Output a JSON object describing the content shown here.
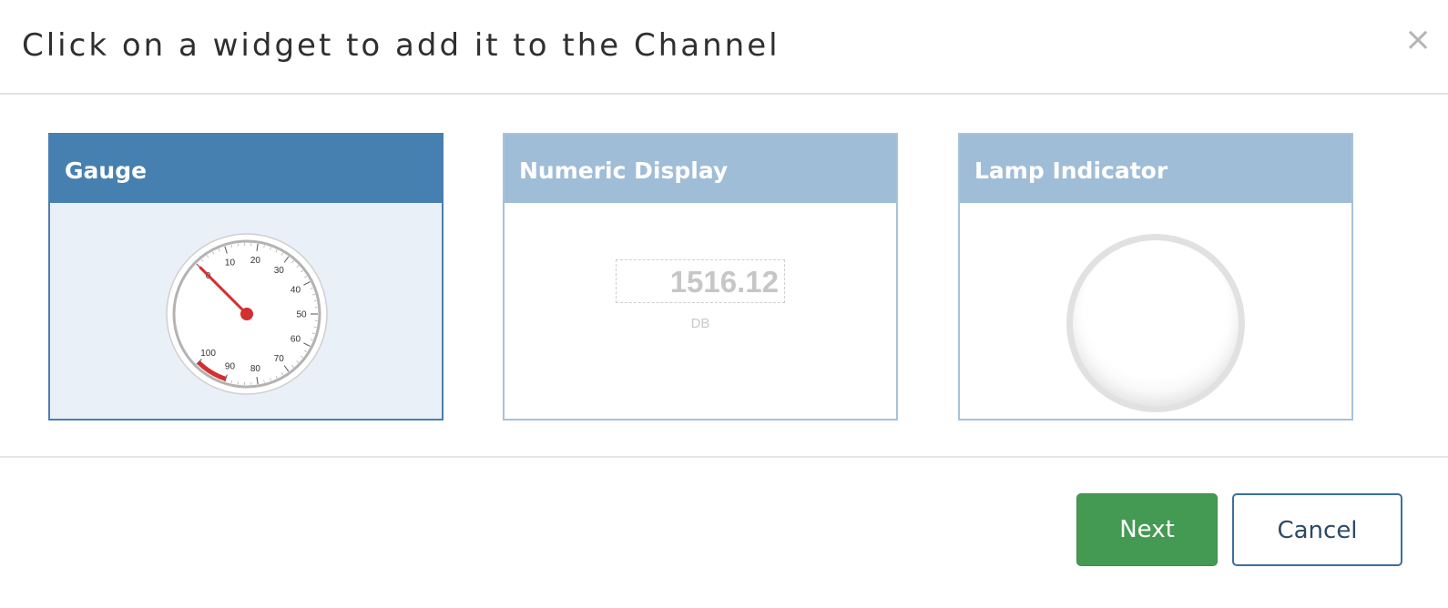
{
  "dialog": {
    "title": "Click on a widget to add it to the Channel",
    "close_label": "×"
  },
  "widgets": [
    {
      "title": "Gauge",
      "selected": true,
      "gauge": {
        "min": 0,
        "max": 100,
        "value": 0,
        "tick_labels": [
          "0",
          "10",
          "20",
          "30",
          "40",
          "50",
          "60",
          "70",
          "80",
          "90",
          "100"
        ],
        "red_zone": [
          90,
          100
        ],
        "needle_color": "#d32f2f"
      }
    },
    {
      "title": "Numeric Display",
      "selected": false,
      "value": "1516.12",
      "unit": "DB"
    },
    {
      "title": "Lamp Indicator",
      "selected": false
    }
  ],
  "footer": {
    "next_label": "Next",
    "cancel_label": "Cancel"
  },
  "colors": {
    "selected_header": "#4580b0",
    "unselected_header": "#a0bdd7",
    "next_button": "#449a52",
    "cancel_border": "#3b6f9e"
  }
}
